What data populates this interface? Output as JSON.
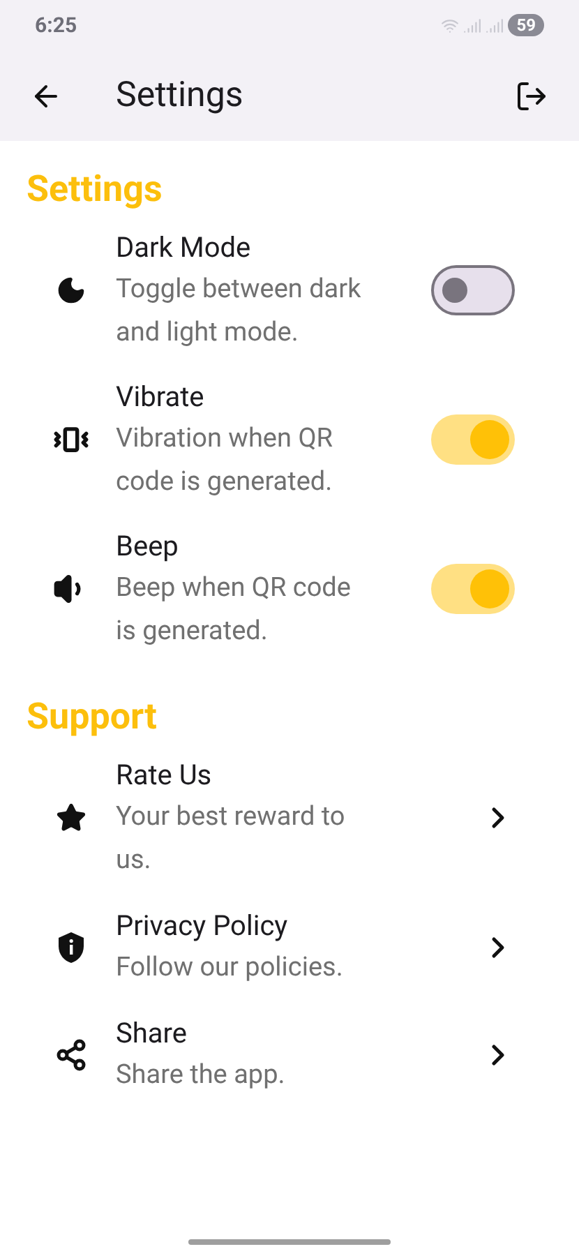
{
  "status_bar": {
    "time": "6:25",
    "battery": "59"
  },
  "app_bar": {
    "title": "Settings"
  },
  "sections": [
    {
      "title": "Settings",
      "items": [
        {
          "kind": "toggle",
          "title": "Dark Mode",
          "subtitle": "Toggle between dark and light mode.",
          "on": false
        },
        {
          "kind": "toggle",
          "title": "Vibrate",
          "subtitle": "Vibration when QR code is generated.",
          "on": true
        },
        {
          "kind": "toggle",
          "title": "Beep",
          "subtitle": "Beep when QR code is generated.",
          "on": true
        }
      ]
    },
    {
      "title": "Support",
      "items": [
        {
          "kind": "link",
          "title": "Rate Us",
          "subtitle": "Your best reward to us."
        },
        {
          "kind": "link",
          "title": "Privacy Policy",
          "subtitle": "Follow our policies."
        },
        {
          "kind": "link",
          "title": "Share",
          "subtitle": "Share the app."
        }
      ]
    }
  ]
}
